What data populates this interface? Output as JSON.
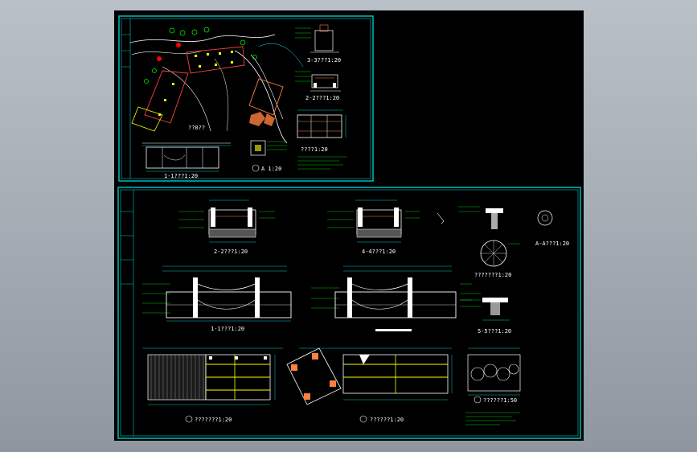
{
  "drawing": {
    "sheet_top": {
      "title_site_plan": "??0??",
      "caption_elevation": "1-1???1:20",
      "caption_detail_a": "A  1:20",
      "caption_section_3": "3-3???1:20",
      "caption_section_2": "2-2???1:20",
      "caption_plan": "????1:20"
    },
    "sheet_bottom": {
      "caption_section_2": "2-2???1:20",
      "caption_section_4": "4-4???1:20",
      "caption_detail_a": "A-A???1:20",
      "caption_section_1": "1-1???1:20",
      "caption_column_plan": "???????1:20",
      "caption_section_5": "5-5???1:20",
      "caption_plan_1": "???????1:20",
      "caption_plan_2": "??????1:20",
      "caption_detail_3": "??????1:50"
    },
    "colors": {
      "frame": "#00c8c8",
      "linework": "#ffffff",
      "highlight": "#ffff00",
      "accent": "#ff0000",
      "vegetation": "#00ff00",
      "dimension": "#00ffff"
    }
  }
}
